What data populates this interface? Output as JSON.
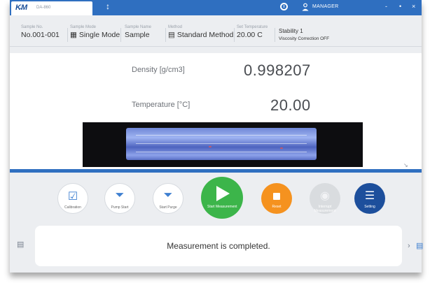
{
  "titlebar": {
    "logo": "K̴M",
    "model": "DA-860",
    "user_name": "MANAGER",
    "window_buttons": [
      "-",
      "•",
      "×"
    ]
  },
  "info": {
    "sample_no": {
      "label": "Sample No.",
      "value": "No.001-001"
    },
    "sample_mode": {
      "label": "Sample Mode",
      "value": "Single Mode"
    },
    "sample_name": {
      "label": "Sample Name",
      "value": "Sample"
    },
    "method": {
      "label": "Method",
      "value": "Standard Method"
    },
    "set_temperature": {
      "label": "Set Temperature",
      "value": "20.00 C"
    },
    "stability": "Stability 1",
    "viscosity": "Viscosity Correction  OFF"
  },
  "readouts": {
    "density_label": "Density [g/cm3]",
    "density_value": "0.998207",
    "temperature_label": "Temperature [°C]",
    "temperature_value": "20.00"
  },
  "buttons": {
    "calibration": "Calibration",
    "pump_start": "Pump Start",
    "start_purge": "Start Purge",
    "start_measurement": "Start Measurement",
    "reset": "Reset",
    "interrupt": "Interrupt Measurement",
    "setting": "Setting"
  },
  "message": "Measurement is completed.",
  "colors": {
    "accent_blue": "#2f6fc0",
    "start_green": "#3cb54a",
    "reset_orange": "#f5921f",
    "setting_navy": "#1d4f9c"
  }
}
